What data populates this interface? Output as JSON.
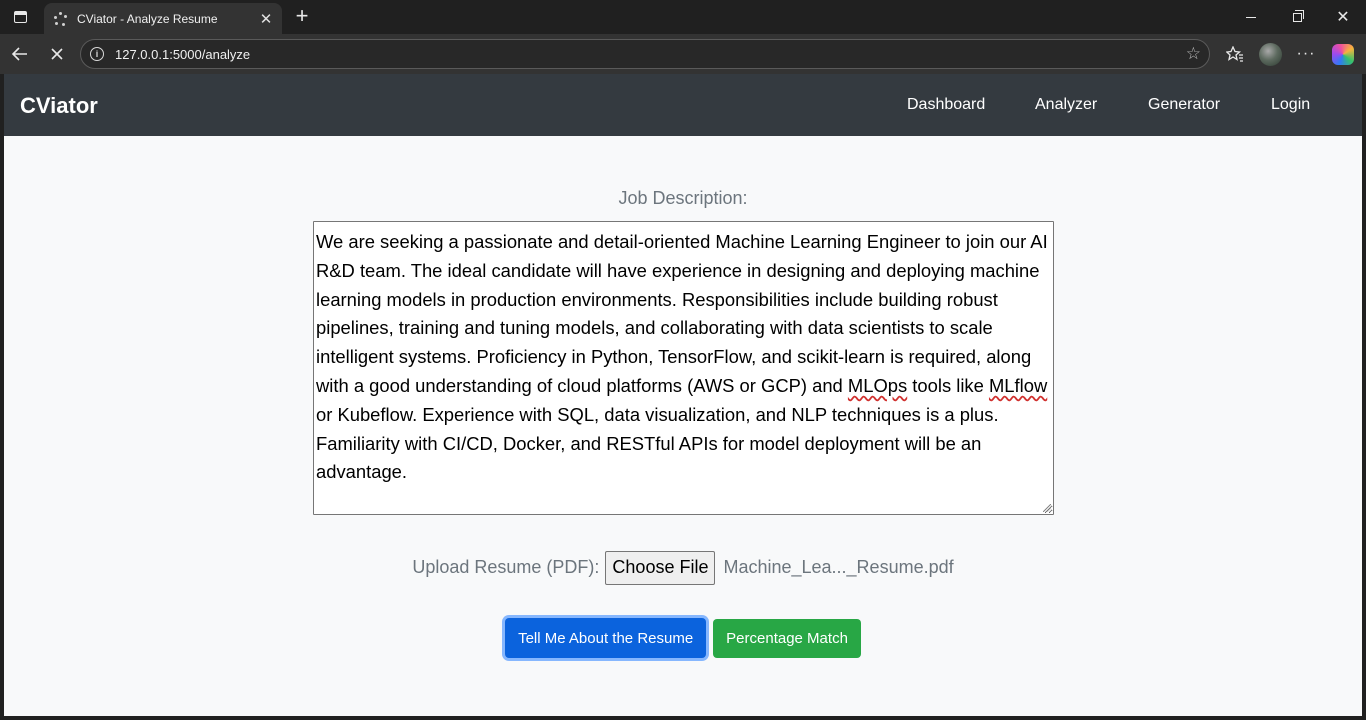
{
  "browser": {
    "tab_title": "CViator - Analyze Resume",
    "tab_close": "✕",
    "new_tab": "+",
    "url": "127.0.0.1:5000/analyze",
    "window_controls": {
      "minimize": "",
      "maximize": "",
      "close": "✕"
    },
    "icons": [
      "sidebar-toggle-icon",
      "loading-spinner-icon",
      "back-arrow-icon",
      "stop-icon",
      "site-info-icon",
      "star-icon",
      "favorites-icon",
      "more-icon",
      "copilot-icon"
    ]
  },
  "navbar": {
    "brand": "CViator",
    "links": [
      "Dashboard",
      "Analyzer",
      "Generator",
      "Login"
    ]
  },
  "form": {
    "job_description_label": "Job Description:",
    "job_description_segments": [
      "We are seeking a passionate and detail-oriented Machine Learning Engineer to join our AI R&D team. The ideal candidate will have experience in designing and deploying machine learning models in production environments. Responsibilities include building robust pipelines, training and tuning models, and collaborating with data scientists to scale intelligent systems. Proficiency in Python, TensorFlow, and scikit-learn is required, along with a good understanding of cloud platforms (AWS or GCP) and ",
      "MLOps",
      " tools like ",
      "MLflow",
      " or Kubeflow. Experience with SQL, data visualization, and NLP techniques is a plus. Familiarity with CI/CD, Docker, and RESTful APIs for model deployment will be an advantage."
    ],
    "upload_label": "Upload Resume (PDF):",
    "choose_file_label": "Choose File",
    "file_name": "Machine_Lea..._Resume.pdf",
    "buttons": {
      "tell_me": "Tell Me About the Resume",
      "percentage_match": "Percentage Match"
    }
  },
  "colors": {
    "navbar_bg": "#343a40",
    "page_bg": "#f8f9fa",
    "primary": "#0b63dd",
    "success": "#28a745",
    "muted_text": "#6c757d"
  }
}
